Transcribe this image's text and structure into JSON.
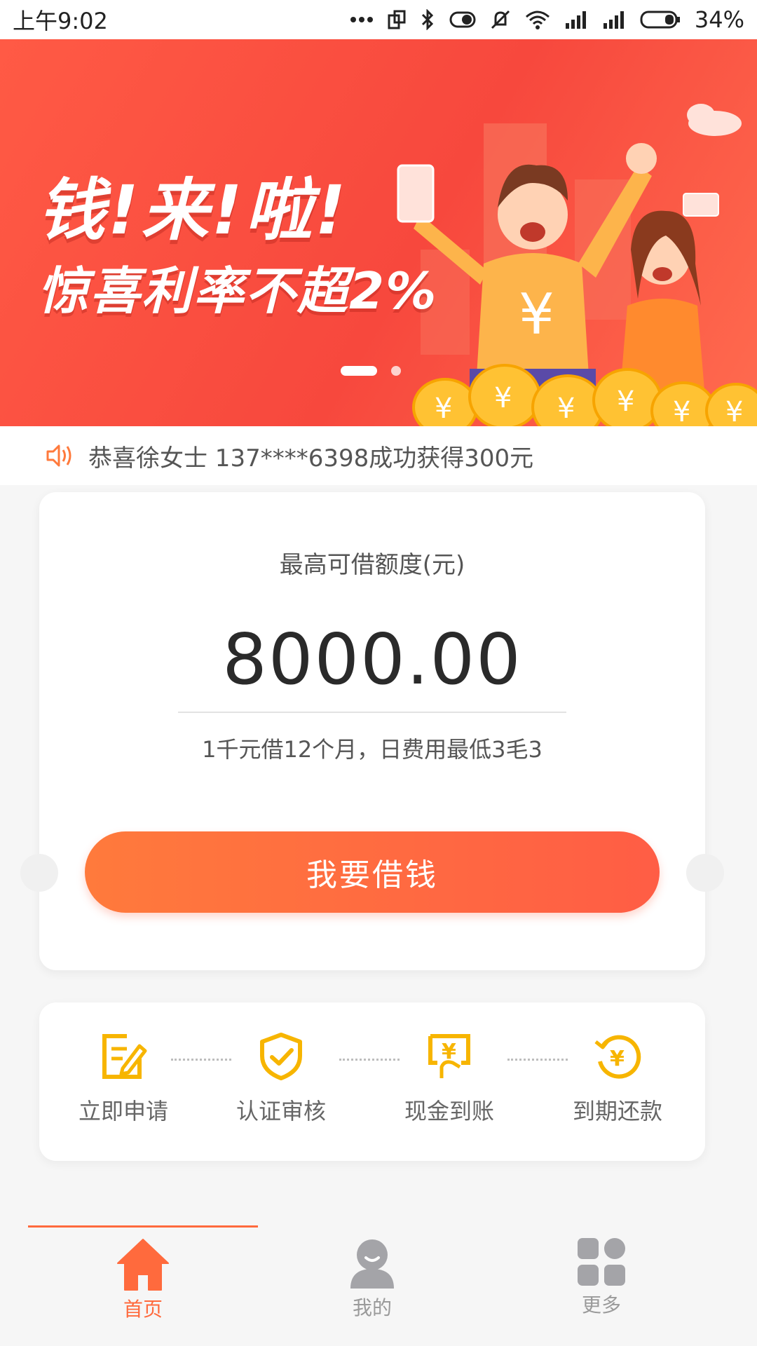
{
  "status_bar": {
    "time": "上午9:02",
    "battery": "34%"
  },
  "banner": {
    "title": "钱!来!啦!",
    "subtitle": "惊喜利率不超2%",
    "slides": 2,
    "active_slide": 1
  },
  "notice": {
    "text": "恭喜徐女士 137****6398成功获得300元"
  },
  "loan_card": {
    "label": "最高可借额度(元)",
    "amount": "8000.00",
    "note": "1千元借12个月，日费用最低3毛3",
    "button_label": "我要借钱"
  },
  "steps": [
    {
      "label": "立即申请",
      "icon": "edit-form-icon"
    },
    {
      "label": "认证审核",
      "icon": "shield-check-icon"
    },
    {
      "label": "现金到账",
      "icon": "cash-in-icon"
    },
    {
      "label": "到期还款",
      "icon": "repay-icon"
    }
  ],
  "tabs": [
    {
      "label": "首页",
      "icon": "home-icon",
      "active": true
    },
    {
      "label": "我的",
      "icon": "person-icon",
      "active": false
    },
    {
      "label": "更多",
      "icon": "grid-icon",
      "active": false
    }
  ],
  "colors": {
    "accent": "#ff6a3d",
    "step_icon": "#f7b500",
    "banner": "#f7483d"
  }
}
